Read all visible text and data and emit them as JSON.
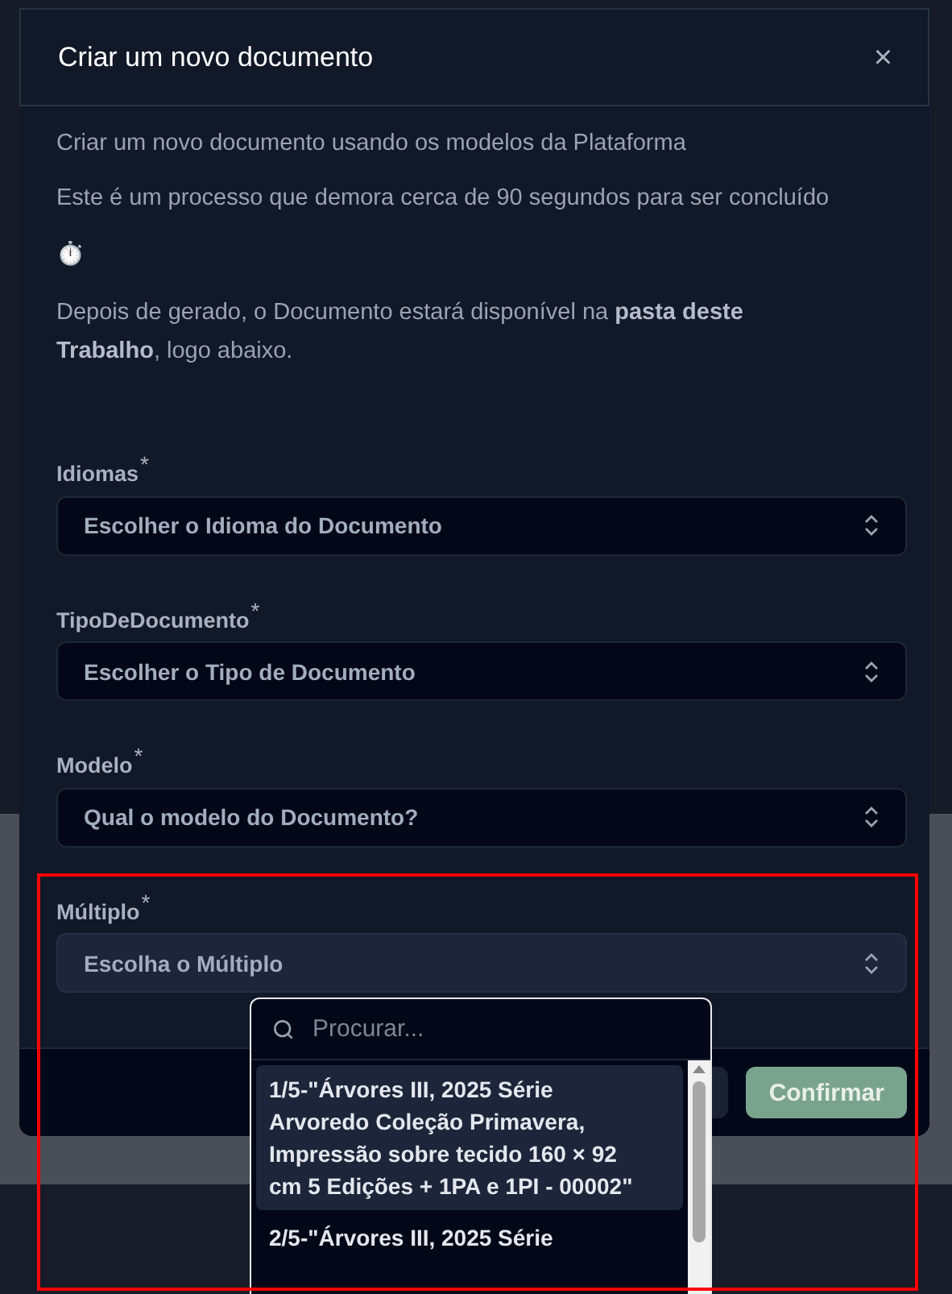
{
  "dialog": {
    "title": "Criar um novo documento",
    "close": "×",
    "paragraphs": [
      "Criar um novo documento usando os modelos da Plataforma",
      "Este é um processo que demora cerca de 90 segundos para ser concluído",
      "⏱️",
      "Depois de gerado, o Documento estará disponível na **pasta deste Trabalho**, logo abaixo."
    ],
    "fields": [
      {
        "label": "Idiomas",
        "required_mark": "*",
        "placeholder": "Escolher o Idioma do Documento",
        "open": false
      },
      {
        "label": "TipoDeDocumento",
        "required_mark": "*",
        "placeholder": "Escolher o Tipo de Documento",
        "open": false
      },
      {
        "label": "Modelo",
        "required_mark": "*",
        "placeholder": "Qual o modelo do Documento?",
        "open": false
      },
      {
        "label": "Múltiplo",
        "required_mark": "*",
        "placeholder": "Escolha o Múltiplo",
        "open": true
      }
    ],
    "confirm_button": "Confirmar"
  },
  "dropdown": {
    "search_placeholder": "Procurar...",
    "options": [
      {
        "label": "1/5-\"Árvores III, 2025 Série Arvoredo Coleção Primavera, Impressão sobre tecido 160 × 92 cm 5 Edições + 1PA e 1PI - 00002\"",
        "selected": true
      },
      {
        "label": "2/5-\"Árvores III, 2025 Série",
        "selected": false
      }
    ]
  }
}
